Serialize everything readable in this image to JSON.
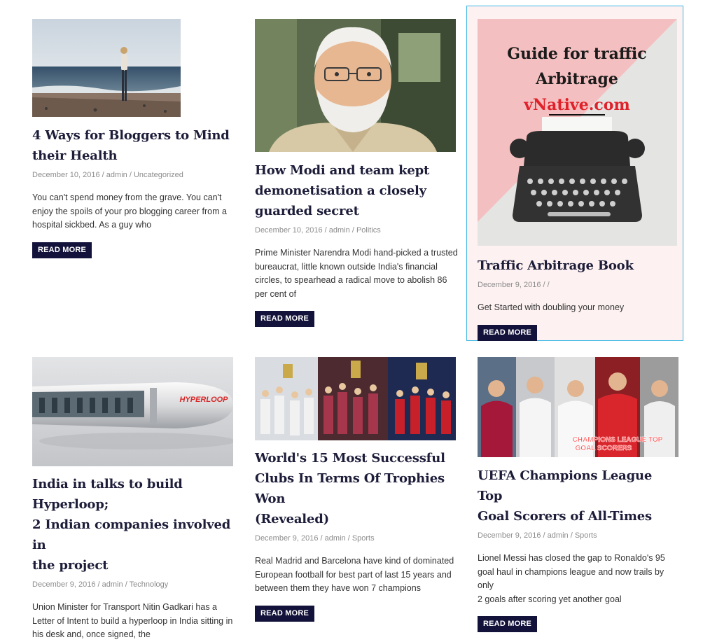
{
  "read_more_label": "READ MORE",
  "posts": [
    {
      "title_lines": [
        "4 Ways for Bloggers to Mind",
        "their Health"
      ],
      "date": "December 10, 2016",
      "author": "admin",
      "category": "Uncategorized",
      "excerpt_lines": [
        "You can't spend money from the grave. You can't",
        "enjoy the spoils of your pro blogging career from a",
        "hospital sickbed. As a guy who"
      ],
      "image": "woman-on-beach-photo"
    },
    {
      "title_lines": [
        "How Modi and team kept",
        "demonetisation a closely",
        "guarded secret"
      ],
      "date": "December 10, 2016",
      "author": "admin",
      "category": "Politics",
      "excerpt_lines": [
        "Prime Minister Narendra Modi hand-picked a trusted",
        "bureaucrat, little known outside India's financial",
        "circles, to spearhead a radical move to abolish 86",
        "per cent of"
      ],
      "image": "modi-portrait-photo"
    },
    {
      "title_lines": [
        "Traffic Arbitrage Book"
      ],
      "date": "December 9, 2016",
      "author": "",
      "category": "",
      "excerpt_lines": [
        "Get Started with doubling your money"
      ],
      "image": "typewriter-book-cover",
      "image_text": [
        "Guide for traffic",
        "Arbitrage",
        "vNative.com"
      ],
      "highlighted": true
    },
    {
      "title_lines": [
        "India in talks to build Hyperloop;",
        "2 Indian companies involved in",
        "the project"
      ],
      "date": "December 9, 2016",
      "author": "admin",
      "category": "Technology",
      "excerpt_lines": [
        "Union Minister for Transport Nitin Gadkari has a",
        "Letter of Intent to build a hyperloop in India sitting in",
        "his desk and, once signed, the"
      ],
      "image": "hyperloop-pod-render",
      "image_text": [
        "HYPERLOOP"
      ]
    },
    {
      "title_lines": [
        "World's 15 Most Successful",
        "Clubs In Terms Of Trophies Won",
        "(Revealed)"
      ],
      "date": "December 9, 2016",
      "author": "admin",
      "category": "Sports",
      "excerpt_lines": [
        "Real Madrid and Barcelona have kind of dominated",
        "European football for best part of last 15 years and",
        "between them they have won 7 champions"
      ],
      "image": "football-clubs-trophies-collage"
    },
    {
      "title_lines": [
        "UEFA Champions League Top",
        "Goal Scorers of All-Times"
      ],
      "date": "December 9, 2016",
      "author": "admin",
      "category": "Sports",
      "excerpt_lines": [
        "Lionel Messi has closed the gap to Ronaldo's 95",
        "goal haul in champions league and now trails by only",
        "2 goals after scoring yet another goal"
      ],
      "image": "champions-league-scorers-collage",
      "image_text": [
        "CHAMPIONS LEAGUE TOP",
        "GOAL SCORERS"
      ]
    }
  ],
  "colors": {
    "button_bg": "#13123a",
    "title": "#1d1d3a",
    "meta": "#8c8c8c",
    "highlight_border": "#3cb6e3",
    "highlight_bg": "#fdf1f1"
  }
}
